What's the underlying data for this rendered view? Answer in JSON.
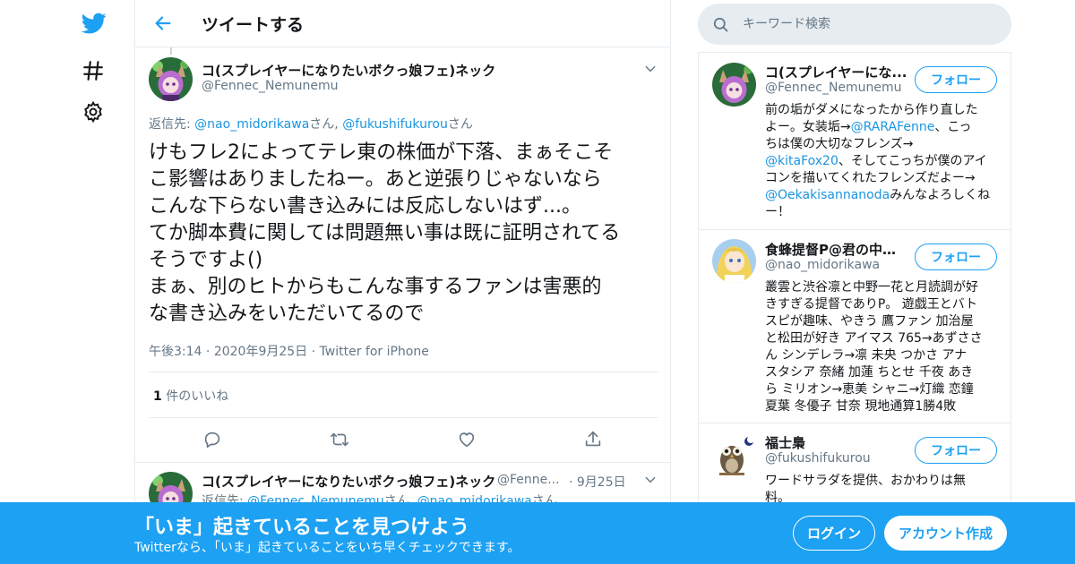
{
  "header": {
    "title": "ツイートする"
  },
  "search": {
    "placeholder": "キーワード検索"
  },
  "tweet": {
    "author_name": "コ(スプレイヤーになりたいボクっ娘フェ)ネック",
    "author_handle": "@Fennec_Nemunemu",
    "reply_prefix": "返信先: ",
    "reply_user1": "@nao_midorikawa",
    "reply_sep": "さん, ",
    "reply_user2": "@fukushifukurou",
    "reply_suffix": "さん",
    "text_lines": [
      "けもフレ2によってテレ東の株価が下落、まぁそこそ",
      "こ影響はありましたねー。あと逆張りじゃないなら",
      "こんな下らない書き込みには反応しないはず...。",
      "てか脚本費に関しては問題無い事は既に証明されてる",
      "そうですよ()",
      "まぁ、別のヒトからもこんな事するファンは害悪的",
      "な書き込みをいただいてるので"
    ],
    "time": "午後3:14",
    "date": "2020年9月25日",
    "source": "Twitter for iPhone",
    "dot": "·",
    "likes_count": "1",
    "likes_label": " 件のいいね"
  },
  "reply": {
    "author_name": "コ(スプレイヤーになりたいボクっ娘フェ)ネック",
    "author_handle": "@Fenne...",
    "date": "· 9月25日",
    "reply_prefix": "返信先: ",
    "reply_user1": "@Fennec_Nemunemu",
    "reply_sep1": "さん, ",
    "reply_user2": "@nao_midorikawa",
    "reply_suffix": "さん,"
  },
  "users": [
    {
      "name": "コ(スプレイヤーにな...",
      "handle": "@Fennec_Nemunemu",
      "follow_label": "フォロー",
      "bio_lines": [
        [
          {
            "t": "前の垢がダメになったから作り直した"
          }
        ],
        [
          {
            "t": "よー。女装垢→"
          },
          {
            "t": "@RARAFenne",
            "link": true
          },
          {
            "t": "、こっ"
          }
        ],
        [
          {
            "t": "ちは僕の大切なフレンズ→"
          }
        ],
        [
          {
            "t": "@kitaFox20",
            "link": true
          },
          {
            "t": "、そしてこっちが僕のアイ"
          }
        ],
        [
          {
            "t": "コンを描いてくれたフレンズだよー→"
          }
        ],
        [
          {
            "t": "@Oekakisannanoda",
            "link": true
          },
          {
            "t": "みんなよろしくね"
          }
        ],
        [
          {
            "t": "ー！"
          }
        ]
      ]
    },
    {
      "name": "食蜂提督P@君の中の...",
      "handle": "@nao_midorikawa",
      "follow_label": "フォロー",
      "bio_lines": [
        [
          {
            "t": "叢雲と渋谷凛と中野一花と月読調が好"
          }
        ],
        [
          {
            "t": "きすぎる提督でありP。 遊戯王とバト"
          }
        ],
        [
          {
            "t": "スピが趣味、やきう 鷹ファン 加治屋"
          }
        ],
        [
          {
            "t": "と松田が好き アイマス 765→あずささ"
          }
        ],
        [
          {
            "t": "ん シンデレラ→凛 未央 つかさ アナ"
          }
        ],
        [
          {
            "t": "スタシア 奈緒 加蓮 ちとせ 千夜 あき"
          }
        ],
        [
          {
            "t": "ら ミリオン→恵美 シャニ→灯織 恋鐘"
          }
        ],
        [
          {
            "t": "夏葉 冬優子 甘奈 現地通算1勝4敗"
          }
        ]
      ]
    },
    {
      "name": "福士梟",
      "handle": "@fukushifukurou",
      "follow_label": "フォロー",
      "bio_lines": [
        [
          {
            "t": "ワードサラダを提供、おかわりは無"
          }
        ],
        [
          {
            "t": "料。"
          }
        ]
      ]
    }
  ],
  "banner": {
    "title": "「いま」起きていることを見つけよう",
    "subtitle": "Twitterなら、「いま」起きていることをいち早くチェックできます。",
    "login_label": "ログイン",
    "signup_label": "アカウント作成"
  },
  "colors": {
    "accent": "#1da1f2",
    "link": "#1b95e0",
    "muted": "#657786",
    "border": "#e6ecf0"
  },
  "icons": {
    "logo": "twitter-bird-icon",
    "explore": "hashtag-icon",
    "settings": "gear-icon",
    "back": "arrow-left-icon",
    "search": "search-icon",
    "reply": "reply-icon",
    "retweet": "retweet-icon",
    "like": "heart-icon",
    "share": "share-icon",
    "more": "chevron-down-icon"
  }
}
